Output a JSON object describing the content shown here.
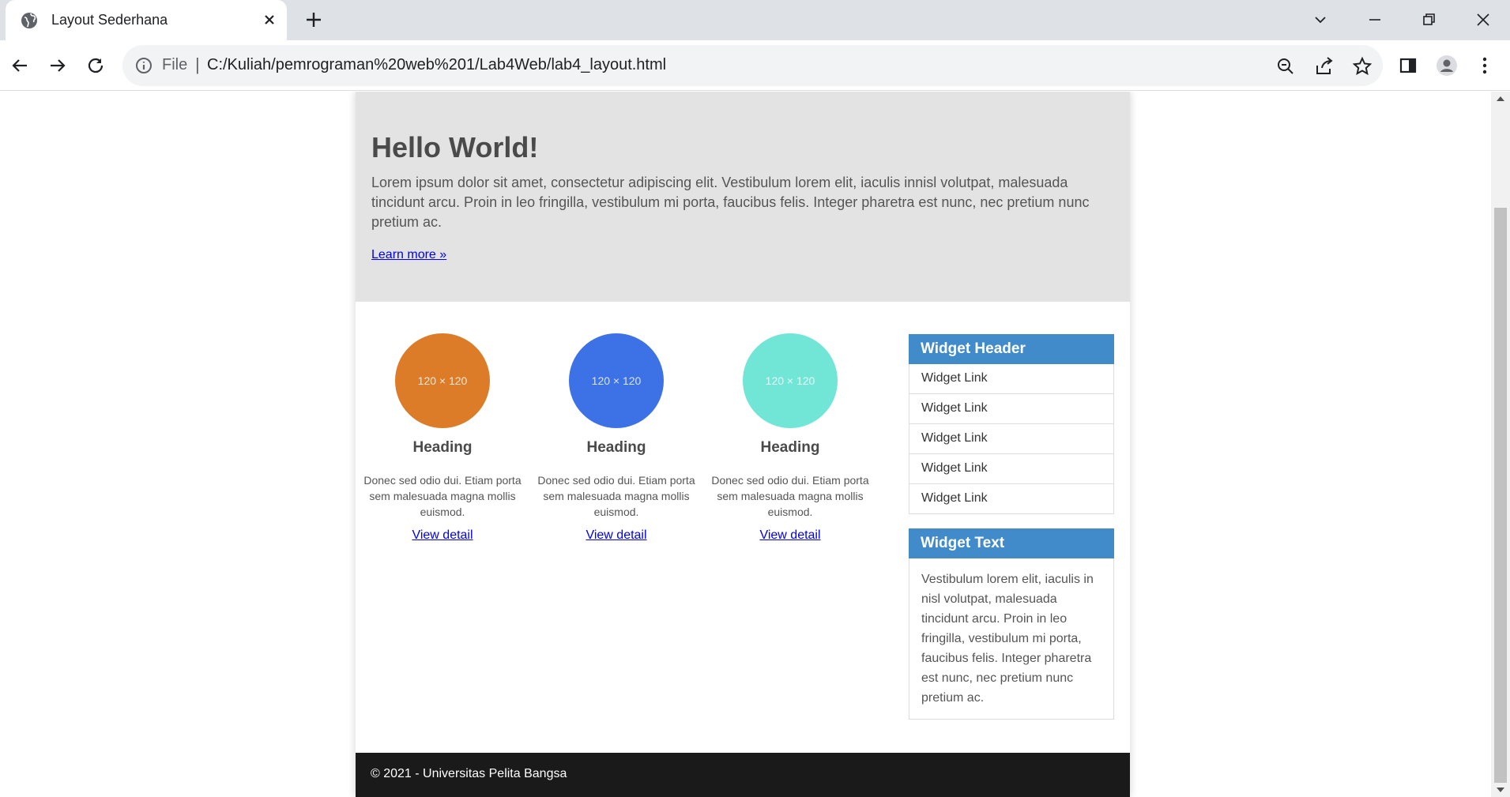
{
  "browser": {
    "tab_title": "Layout Sederhana",
    "scheme_label": "File",
    "url": "C:/Kuliah/pemrograman%20web%201/Lab4Web/lab4_layout.html"
  },
  "page": {
    "hero": {
      "title": "Hello World!",
      "text": "Lorem ipsum dolor sit amet, consectetur adipiscing elit. Vestibulum lorem elit, iaculis innisl volutpat, malesuada tincidunt arcu. Proin in leo fringilla, vestibulum mi porta, faucibus felis. Integer pharetra est nunc, nec pretium nunc pretium ac.",
      "link": "Learn more »"
    },
    "features": [
      {
        "placeholder": "120 × 120",
        "color": "#dd7c28",
        "heading": "Heading",
        "text": "Donec sed odio dui. Etiam porta sem malesuada magna mollis euismod.",
        "link": "View detail"
      },
      {
        "placeholder": "120 × 120",
        "color": "#3d72e6",
        "heading": "Heading",
        "text": "Donec sed odio dui. Etiam porta sem malesuada magna mollis euismod.",
        "link": "View detail"
      },
      {
        "placeholder": "120 × 120",
        "color": "#72e6d6",
        "heading": "Heading",
        "text": "Donec sed odio dui. Etiam porta sem malesuada magna mollis euismod.",
        "link": "View detail"
      }
    ],
    "widget_links": {
      "header": "Widget Header",
      "items": [
        "Widget Link",
        "Widget Link",
        "Widget Link",
        "Widget Link",
        "Widget Link"
      ]
    },
    "widget_text": {
      "header": "Widget Text",
      "body": "Vestibulum lorem elit, iaculis in nisl volutpat, malesuada tincidunt arcu. Proin in leo fringilla, vestibulum mi porta, faucibus felis. Integer pharetra est nunc, nec pretium nunc pretium ac."
    },
    "footer": "© 2021 - Universitas Pelita Bangsa"
  },
  "colors": {
    "hero_bg": "#e3e3e3",
    "widget_header": "#428bca",
    "footer_bg": "#1a1a1a"
  }
}
